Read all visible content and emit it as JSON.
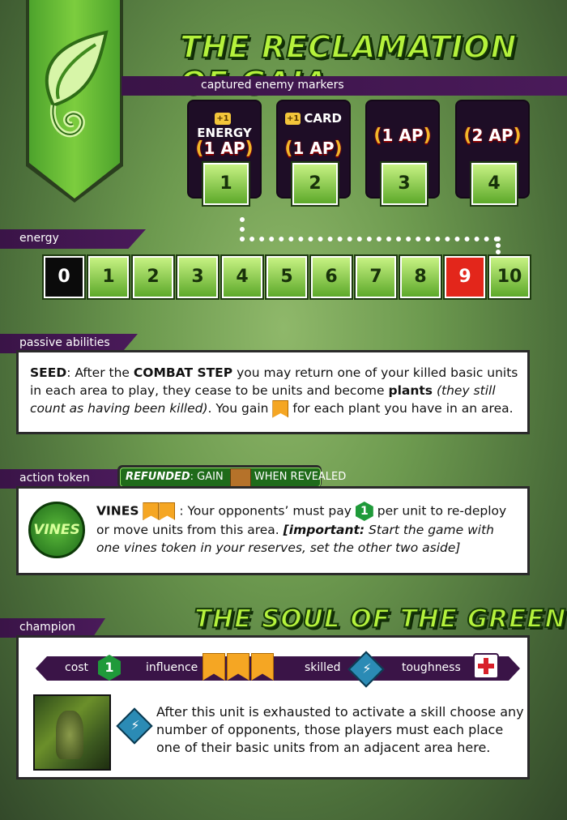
{
  "title": "THE RECLAMATION OF GAIA",
  "captured": {
    "label": "captured enemy markers",
    "cards": [
      {
        "bonus_tag": "+1",
        "bonus_text": "ENERGY",
        "ap": "1 AP",
        "number": "1"
      },
      {
        "bonus_tag": "+1",
        "bonus_text": "CARD",
        "ap": "1 AP",
        "number": "2"
      },
      {
        "bonus_tag": "",
        "bonus_text": "",
        "ap": "1 AP",
        "number": "3"
      },
      {
        "bonus_tag": "",
        "bonus_text": "",
        "ap": "2 AP",
        "number": "4"
      }
    ]
  },
  "energy": {
    "label": "energy",
    "track": [
      "0",
      "1",
      "2",
      "3",
      "4",
      "5",
      "6",
      "7",
      "8",
      "9",
      "10"
    ]
  },
  "passive": {
    "label": "passive abilities",
    "p1": "SEED",
    "p2": ": After the ",
    "p3": "COMBAT STEP",
    "p4": " you may return one of your killed basic units in each area to play, they cease to be units and become ",
    "p5": "plants",
    "p6": " (they still count as having been killed)",
    "p7": ". You gain ",
    "p8": " for each plant you have in an area."
  },
  "action": {
    "label": "action token",
    "refund_label": "REFUNDED",
    "refund_gain": ": GAIN",
    "refund_when": "WHEN REVEALED",
    "token_text": "VINES",
    "name": "VINES",
    "t1": " : Your opponents’ must pay ",
    "hex_value": "1",
    "t2": " per unit to re-deploy or move units from this area. ",
    "t3": "[important:",
    "t4": " Start the game with one vines token in your reserves, set the other two aside]"
  },
  "champion": {
    "label": "champion",
    "name": "THE SOUL OF THE GREEN",
    "cost_label": "cost",
    "cost_value": "1",
    "influence_label": "influence",
    "skilled_label": "skilled",
    "toughness_label": "toughness",
    "skill_glyph": "⚡",
    "ability": "After this unit is exhausted to activate a skill choose any number of opponents, those players must each place one of their basic units from an adjacent area here."
  },
  "colors": {
    "accent_green": "#b5f23c",
    "strip_purple": "#3a1447",
    "energy_red": "#e3261b"
  },
  "icons": [
    "leaf-icon",
    "laurel-icon",
    "influence-icon",
    "crate-icon",
    "vines-token-icon",
    "cost-hex-icon",
    "skill-icon",
    "toughness-icon",
    "champion-portrait"
  ]
}
